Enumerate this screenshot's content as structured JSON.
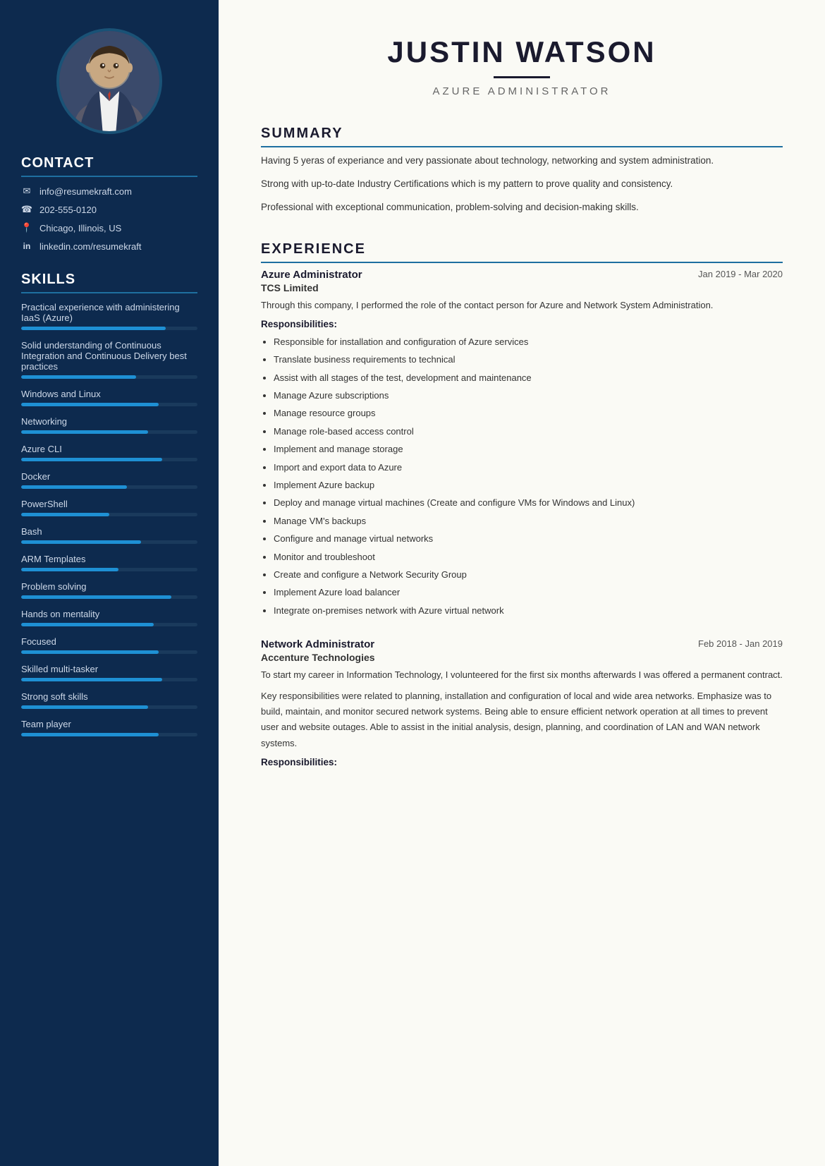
{
  "candidate": {
    "name": "JUSTIN WATSON",
    "title": "AZURE ADMINISTRATOR"
  },
  "sidebar": {
    "contact_title": "CONTACT",
    "contact_items": [
      {
        "icon": "email-icon",
        "text": "info@resumekraft.com"
      },
      {
        "icon": "phone-icon",
        "text": "202-555-0120"
      },
      {
        "icon": "location-icon",
        "text": "Chicago, Illinois, US"
      },
      {
        "icon": "linkedin-icon",
        "text": "linkedin.com/resumekraft"
      }
    ],
    "skills_title": "SKILLS",
    "skills": [
      {
        "label": "Practical experience with administering IaaS (Azure)",
        "pct": 82
      },
      {
        "label": "Solid understanding of Continuous Integration and Continuous Delivery best practices",
        "pct": 65
      },
      {
        "label": "Windows and Linux",
        "pct": 78
      },
      {
        "label": "Networking",
        "pct": 72
      },
      {
        "label": "Azure CLI",
        "pct": 80
      },
      {
        "label": "Docker",
        "pct": 60
      },
      {
        "label": "PowerShell",
        "pct": 50
      },
      {
        "label": "Bash",
        "pct": 68
      },
      {
        "label": "ARM Templates",
        "pct": 55
      },
      {
        "label": "Problem solving",
        "pct": 85
      },
      {
        "label": "Hands on mentality",
        "pct": 75
      },
      {
        "label": "Focused",
        "pct": 78
      },
      {
        "label": "Skilled multi-tasker",
        "pct": 80
      },
      {
        "label": "Strong soft skills",
        "pct": 72
      },
      {
        "label": "Team player",
        "pct": 78
      }
    ]
  },
  "summary": {
    "section_title": "SUMMARY",
    "paragraphs": [
      "Having 5 yeras of experiance and very passionate about technology, networking and system administration.",
      "Strong with up-to-date Industry Certifications which is my pattern to prove quality and consistency.",
      "Professional with exceptional communication, problem-solving and decision-making skills."
    ]
  },
  "experience": {
    "section_title": "EXPERIENCE",
    "entries": [
      {
        "job_title": "Azure Administrator",
        "dates": "Jan 2019 - Mar 2020",
        "company": "TCS Limited",
        "desc": "Through this company, I performed the role of the contact person for Azure and Network System Administration.",
        "resp_label": "Responsibilities:",
        "responsibilities": [
          "Responsible for installation and configuration of Azure services",
          "Translate business requirements to technical",
          "Assist with all stages of the test, development and maintenance",
          "Manage Azure subscriptions",
          "Manage resource groups",
          "Manage role-based access control",
          "Implement and manage storage",
          "Import and export data to Azure",
          "Implement Azure backup",
          "Deploy and manage virtual machines (Create and configure VMs for Windows and Linux)",
          "Manage VM's backups",
          "Configure and manage virtual networks",
          "Monitor and troubleshoot",
          "Create and configure a Network Security Group",
          "Implement Azure load balancer",
          "Integrate on-premises network with Azure virtual network"
        ]
      },
      {
        "job_title": "Network Administrator",
        "dates": "Feb 2018 - Jan 2019",
        "company": "Accenture Technologies",
        "desc": "To start my career in Information Technology, I volunteered for the first six months afterwards I was offered a permanent contract.",
        "desc2": "Key responsibilities were related to planning, installation and configuration of local and wide area networks. Emphasize was to build, maintain, and monitor secured network systems. Being able to ensure efficient network operation at all times to prevent user and website outages. Able to assist in the initial analysis, design, planning, and coordination of LAN and WAN network systems.",
        "resp_label": "Responsibilities:",
        "responsibilities": []
      }
    ]
  }
}
